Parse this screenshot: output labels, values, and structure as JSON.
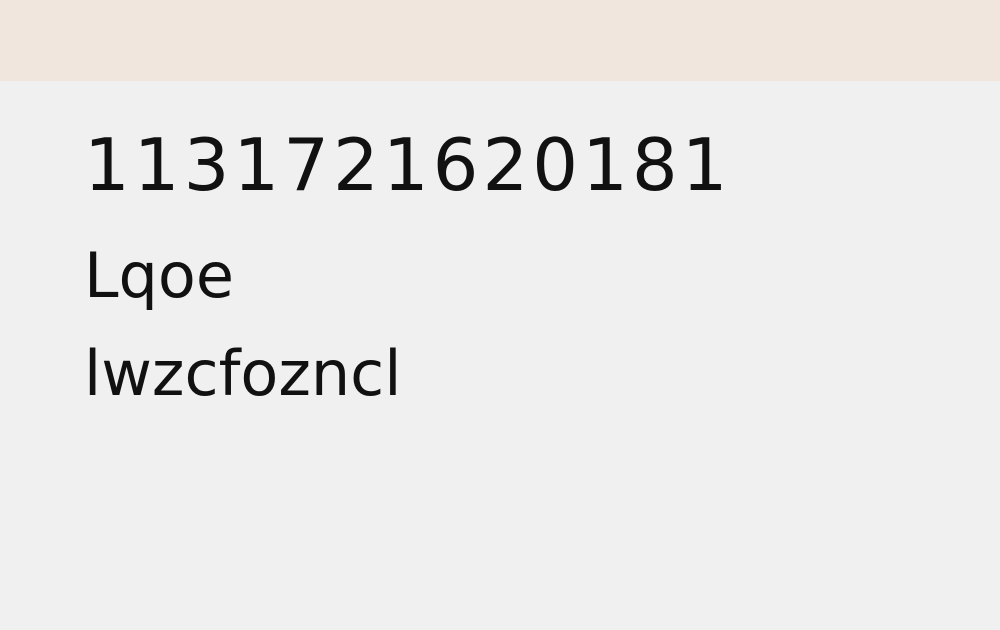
{
  "header": {
    "background": "#f0e6de"
  },
  "main": {
    "background": "#f0f0f0",
    "text_color": "#111111",
    "lines": [
      "1131721620181",
      "Lqoe",
      "lwzcfozncl"
    ]
  }
}
